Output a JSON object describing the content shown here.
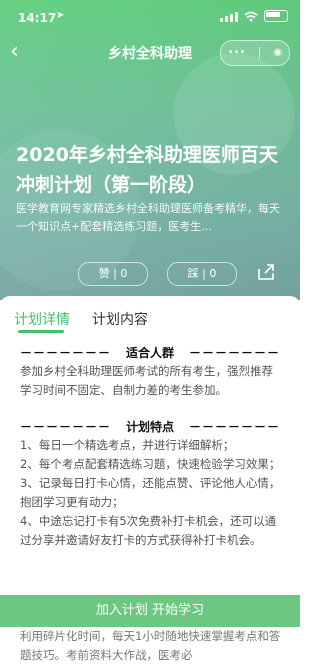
{
  "status": {
    "time": "14:17"
  },
  "nav": {
    "title": "乡村全科助理"
  },
  "plan": {
    "title": "2020年乡村全科助理医师百天冲刺计划（第一阶段）",
    "description": "医学教育网专家精选乡村全科助理医师备考精华，每天一个知识点+配套精选练习题，医考生...",
    "like_label": "赞 | 0",
    "dislike_label": "踩 | 0"
  },
  "tabs": [
    {
      "label": "计划详情"
    },
    {
      "label": "计划内容"
    }
  ],
  "sections": {
    "audience": {
      "dash_left": "－－－－－－－",
      "title": "适合人群",
      "dash_right": "－－－－－－－",
      "text": "参加乡村全科助理医师考试的所有考生，强烈推荐学习时间不固定、自制力差的考生参加。"
    },
    "features": {
      "dash_left": "－－－－－－－",
      "title": "计划特点",
      "dash_right": "－－－－－－－",
      "text": "1、每日一个精选考点，并进行详细解析；\n2、每个考点配套精选练习题，快速检验学习效果；\n3、记录每日打卡心情，还能点赞、评论他人心情，抱团学习更有动力；\n4、中途忘记打卡有5次免费补打卡机会，还可以通过分享并邀请好友打卡的方式获得补打卡机会。"
    }
  },
  "bottom": {
    "button_label": "加入计划 开始学习",
    "under_text": "利用碎片化时间，每天1小时随地快速掌握考点和答题技巧。考前资料大作战，医考必"
  },
  "colors": {
    "accent": "#44bf6a",
    "button": "#6cc780"
  }
}
